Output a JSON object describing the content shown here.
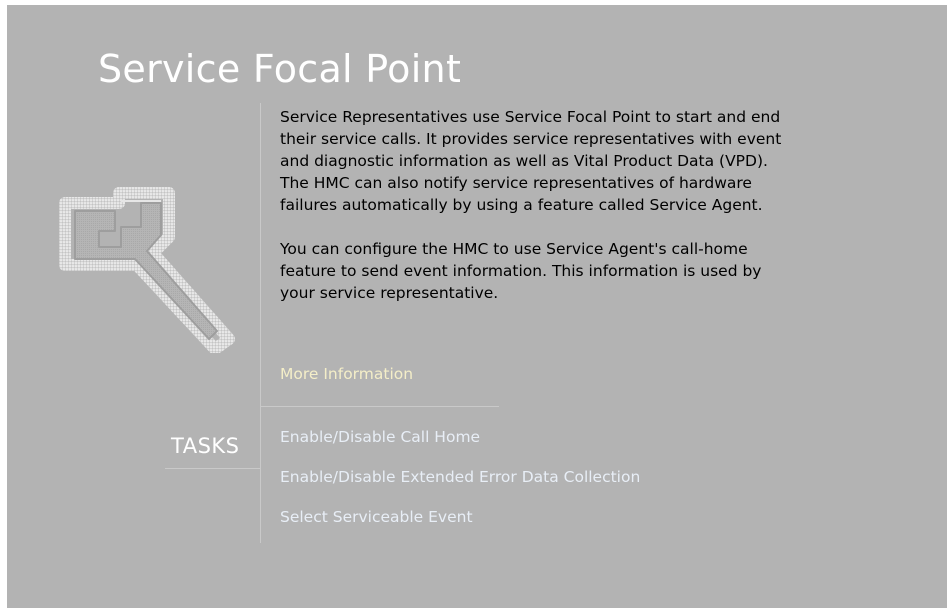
{
  "page": {
    "title": "Service Focal Point",
    "description": [
      "Service Representatives use Service Focal Point to start and end their service calls.  It provides service representatives with event and diagnostic information as well as Vital Product Data (VPD). The HMC can also notify service representatives of hardware failures automatically by using a feature called Service Agent.",
      "You can configure the HMC to use Service Agent's call-home feature to send event information. This information is used by your service representative."
    ],
    "description_lines": [
      [
        "Service Representatives use Service Focal Point to start and end",
        "their service calls.  It provides service representatives with event",
        "and diagnostic information as well as Vital Product Data (VPD).",
        "The HMC can also notify service representatives of hardware",
        "failures automatically by using a feature called Service Agent."
      ],
      [
        "You can configure the HMC to use Service Agent's call-home",
        "feature to send event information. This information is used by",
        "your service representative."
      ]
    ],
    "more_info_link": "More Information",
    "icon": "wrench-icon"
  },
  "tasks": {
    "label": "TASKS",
    "items": [
      "Enable/Disable Call Home",
      "Enable/Disable Extended Error Data Collection",
      "Select Serviceable Event"
    ]
  },
  "colors": {
    "background": "#b3b3b3",
    "title": "#ffffff",
    "link_more_info": "#f4eec8",
    "link_task": "#e8eef6",
    "divider": "#c9c9c9"
  }
}
